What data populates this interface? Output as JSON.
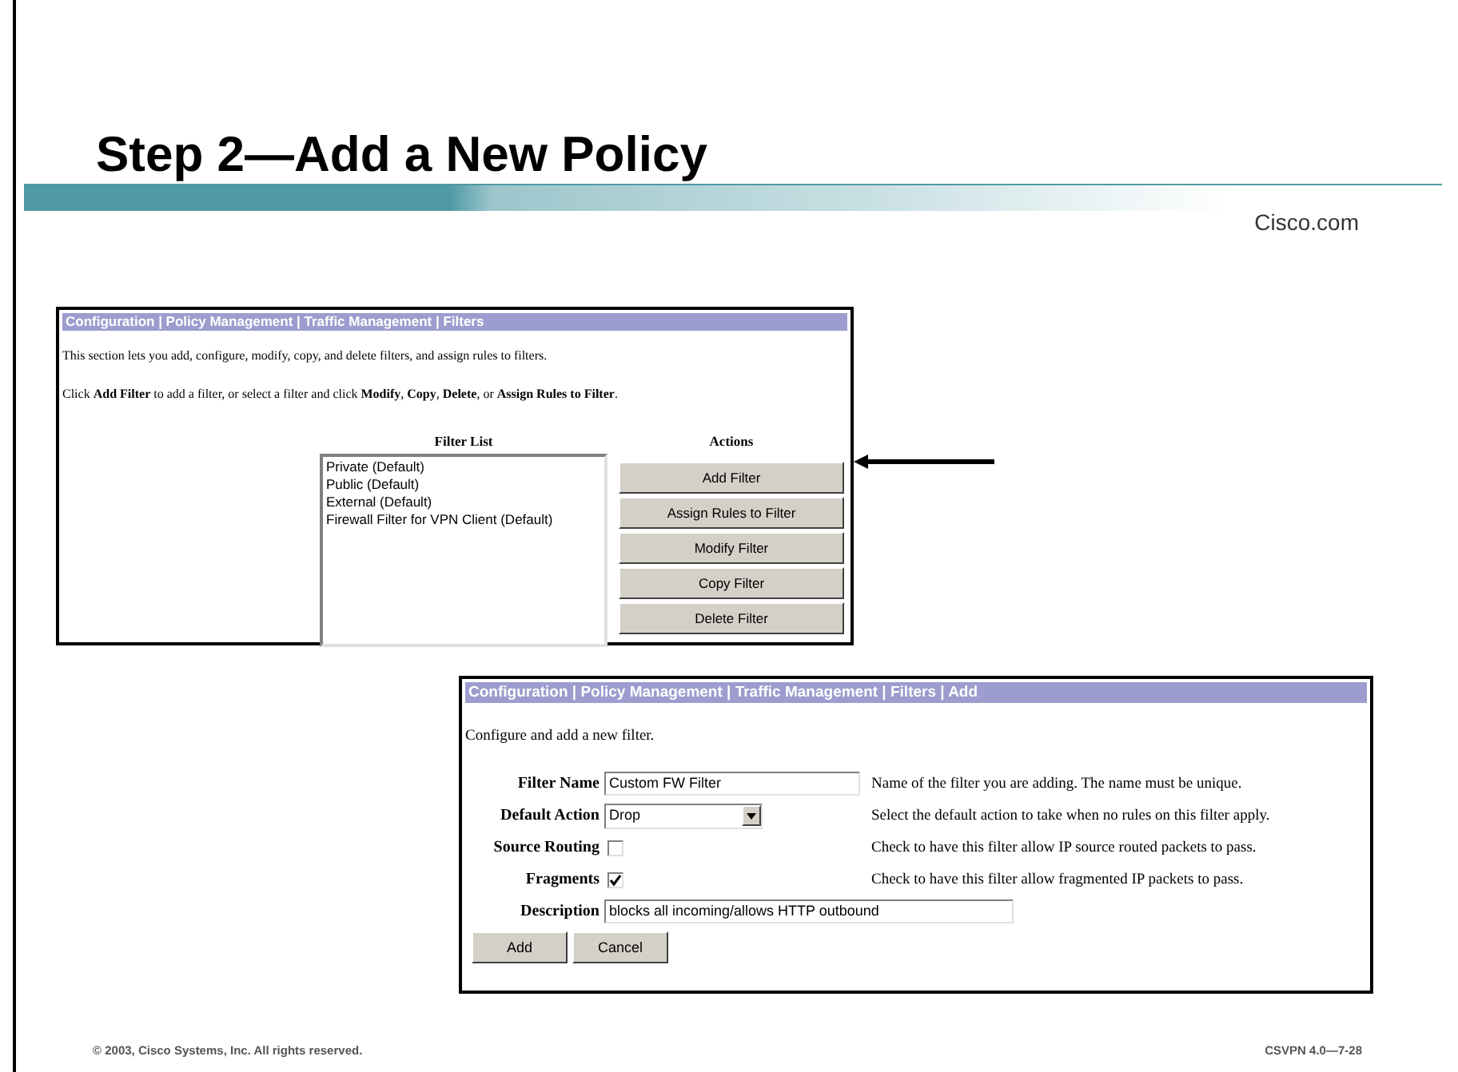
{
  "slide": {
    "title": "Step 2—Add a New Policy",
    "brand": "Cisco.com"
  },
  "filters_screen": {
    "breadcrumb": "Configuration | Policy Management | Traffic Management | Filters",
    "intro": "This section lets you add, configure, modify, copy, and delete filters, and assign rules to filters.",
    "instruction": "Click **Add Filter** to add a filter, or select a filter and click **Modify**, **Copy**, **Delete**, or **Assign Rules to Filter**.",
    "list_heading": "Filter List",
    "actions_heading": "Actions",
    "filters": [
      {
        "label": "Private (Default)"
      },
      {
        "label": "Public (Default)"
      },
      {
        "label": "External (Default)"
      },
      {
        "label": "Firewall Filter for VPN Client (Default)"
      }
    ],
    "buttons": [
      "Add Filter",
      "Assign Rules to Filter",
      "Modify Filter",
      "Copy Filter",
      "Delete Filter"
    ]
  },
  "add_screen": {
    "breadcrumb": "Configuration | Policy Management | Traffic Management | Filters | Add",
    "intro": "Configure and add a new filter.",
    "fields": [
      {
        "kind": "text",
        "label": "Filter Name",
        "value": "Custom FW Filter",
        "help": "Name of the filter you are adding. The name must be unique."
      },
      {
        "kind": "select",
        "label": "Default Action",
        "value": "Drop",
        "help": "Select the default action to take when no rules on this filter apply."
      },
      {
        "kind": "checkbox",
        "label": "Source Routing",
        "checked": false,
        "help": "Check to have this filter allow IP source routed packets to pass."
      },
      {
        "kind": "checkbox",
        "label": "Fragments",
        "checked": true,
        "help": "Check to have this filter allow fragmented IP packets to pass."
      },
      {
        "kind": "wide_text",
        "label": "Description",
        "value": "blocks all incoming/allows HTTP outbound"
      }
    ],
    "buttons": [
      "Add",
      "Cancel"
    ]
  },
  "footer": {
    "copyright": "© 2003, Cisco Systems, Inc. All rights reserved.",
    "code": "CSVPN 4.0—7-28"
  }
}
